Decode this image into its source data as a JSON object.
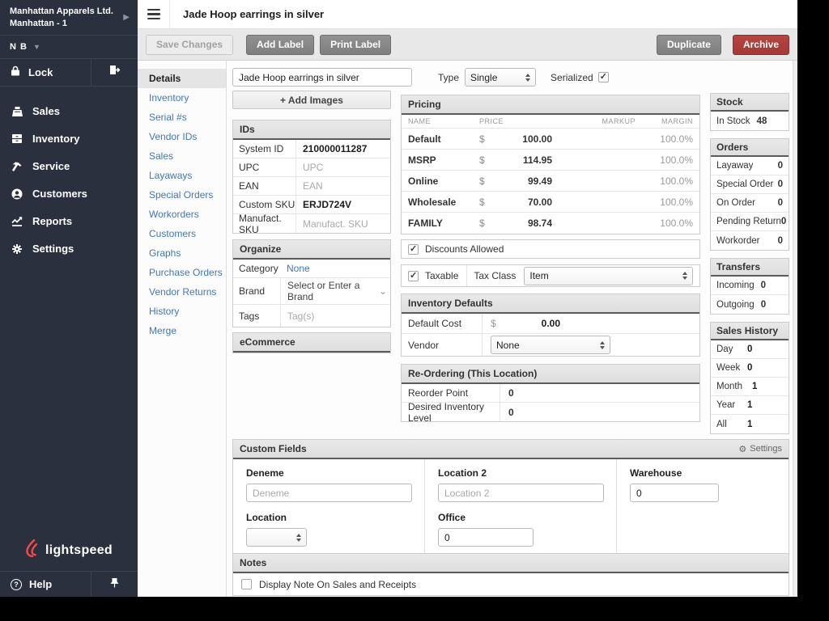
{
  "colors": {
    "sidebar_bg": "#2a303d",
    "link_blue": "#4077b8",
    "archive_red": "#ab3d3a",
    "logo_red": "#f04a4d",
    "button_gray": "#878787"
  },
  "sidebar": {
    "shop_name": "Manhattan Apparels Ltd.",
    "shop_location": "Manhattan - 1",
    "user": "N B",
    "lock": "Lock",
    "menu": [
      {
        "label": "Sales"
      },
      {
        "label": "Inventory"
      },
      {
        "label": "Service"
      },
      {
        "label": "Customers"
      },
      {
        "label": "Reports"
      },
      {
        "label": "Settings"
      }
    ],
    "logo": "lightspeed",
    "help": "Help"
  },
  "header": {
    "title": "Jade Hoop earrings in silver"
  },
  "toolbar": {
    "save": "Save Changes",
    "add_label": "Add Label",
    "print_label": "Print Label",
    "duplicate": "Duplicate",
    "archive": "Archive"
  },
  "subnav": {
    "items": [
      {
        "label": "Details"
      },
      {
        "label": "Inventory"
      },
      {
        "label": "Serial #s"
      },
      {
        "label": "Vendor IDs"
      },
      {
        "label": "Sales"
      },
      {
        "label": "Layaways"
      },
      {
        "label": "Special Orders"
      },
      {
        "label": "Workorders"
      },
      {
        "label": "Customers"
      },
      {
        "label": "Graphs"
      },
      {
        "label": "Purchase Orders"
      },
      {
        "label": "Vendor Returns"
      },
      {
        "label": "History"
      },
      {
        "label": "Merge"
      }
    ]
  },
  "product": {
    "name": "Jade Hoop earrings in silver",
    "type_label": "Type",
    "type_value": "Single",
    "serialized_label": "Serialized",
    "add_images": "+ Add Images"
  },
  "ids": {
    "title": "IDs",
    "rows": [
      {
        "label": "System ID",
        "value": "210000011287",
        "placeholder": ""
      },
      {
        "label": "UPC",
        "value": "",
        "placeholder": "UPC"
      },
      {
        "label": "EAN",
        "value": "",
        "placeholder": "EAN"
      },
      {
        "label": "Custom SKU",
        "value": "ERJD724V",
        "placeholder": ""
      },
      {
        "label": "Manufact. SKU",
        "value": "",
        "placeholder": "Manufact. SKU"
      }
    ]
  },
  "organize": {
    "title": "Organize",
    "category_label": "Category",
    "category_value": "None",
    "brand_label": "Brand",
    "brand_placeholder": "Select or Enter a Brand",
    "tags_label": "Tags",
    "tags_placeholder": "Tag(s)"
  },
  "ecommerce": {
    "title": "eCommerce"
  },
  "pricing": {
    "title": "Pricing",
    "columns": {
      "name": "NAME",
      "price": "PRICE",
      "markup": "MARKUP",
      "margin": "MARGIN"
    },
    "rows": [
      {
        "name": "Default",
        "currency": "$",
        "price": "100.00",
        "margin": "100.0%"
      },
      {
        "name": "MSRP",
        "currency": "$",
        "price": "114.95",
        "margin": "100.0%"
      },
      {
        "name": "Online",
        "currency": "$",
        "price": "99.49",
        "margin": "100.0%"
      },
      {
        "name": "Wholesale",
        "currency": "$",
        "price": "70.00",
        "margin": "100.0%"
      },
      {
        "name": "FAMILY",
        "currency": "$",
        "price": "98.74",
        "margin": "100.0%"
      }
    ],
    "discounts_label": "Discounts Allowed",
    "taxable_label": "Taxable",
    "tax_class_label": "Tax Class",
    "tax_class_value": "Item"
  },
  "inventory_defaults": {
    "title": "Inventory Defaults",
    "default_cost_label": "Default Cost",
    "currency": "$",
    "default_cost_value": "0.00",
    "vendor_label": "Vendor",
    "vendor_value": "None"
  },
  "reordering": {
    "title": "Re-Ordering (This Location)",
    "rows": [
      {
        "label": "Reorder Point",
        "value": "0"
      },
      {
        "label": "Desired Inventory Level",
        "value": "0"
      }
    ]
  },
  "stock": {
    "title": "Stock",
    "rows": [
      {
        "label": "In Stock",
        "value": "48"
      }
    ]
  },
  "orders": {
    "title": "Orders",
    "rows": [
      {
        "label": "Layaway",
        "value": "0"
      },
      {
        "label": "Special Order",
        "value": "0"
      },
      {
        "label": "On Order",
        "value": "0"
      },
      {
        "label": "Pending Return",
        "value": "0"
      },
      {
        "label": "Workorder",
        "value": "0"
      }
    ]
  },
  "transfers": {
    "title": "Transfers",
    "rows": [
      {
        "label": "Incoming",
        "value": "0"
      },
      {
        "label": "Outgoing",
        "value": "0"
      }
    ]
  },
  "sales_history": {
    "title": "Sales History",
    "rows": [
      {
        "label": "Day",
        "value": "0"
      },
      {
        "label": "Week",
        "value": "0"
      },
      {
        "label": "Month",
        "value": "1"
      },
      {
        "label": "Year",
        "value": "1"
      },
      {
        "label": "All",
        "value": "1"
      }
    ]
  },
  "custom_fields": {
    "title": "Custom Fields",
    "settings_label": "Settings",
    "deneme_label": "Deneme",
    "deneme_placeholder": "Deneme",
    "location_label": "Location",
    "location2_label": "Location 2",
    "location2_placeholder": "Location 2",
    "office_label": "Office",
    "office_value": "0",
    "warehouse_label": "Warehouse",
    "warehouse_value": "0"
  },
  "notes": {
    "title": "Notes",
    "display_note_label": "Display Note On Sales and Receipts"
  }
}
